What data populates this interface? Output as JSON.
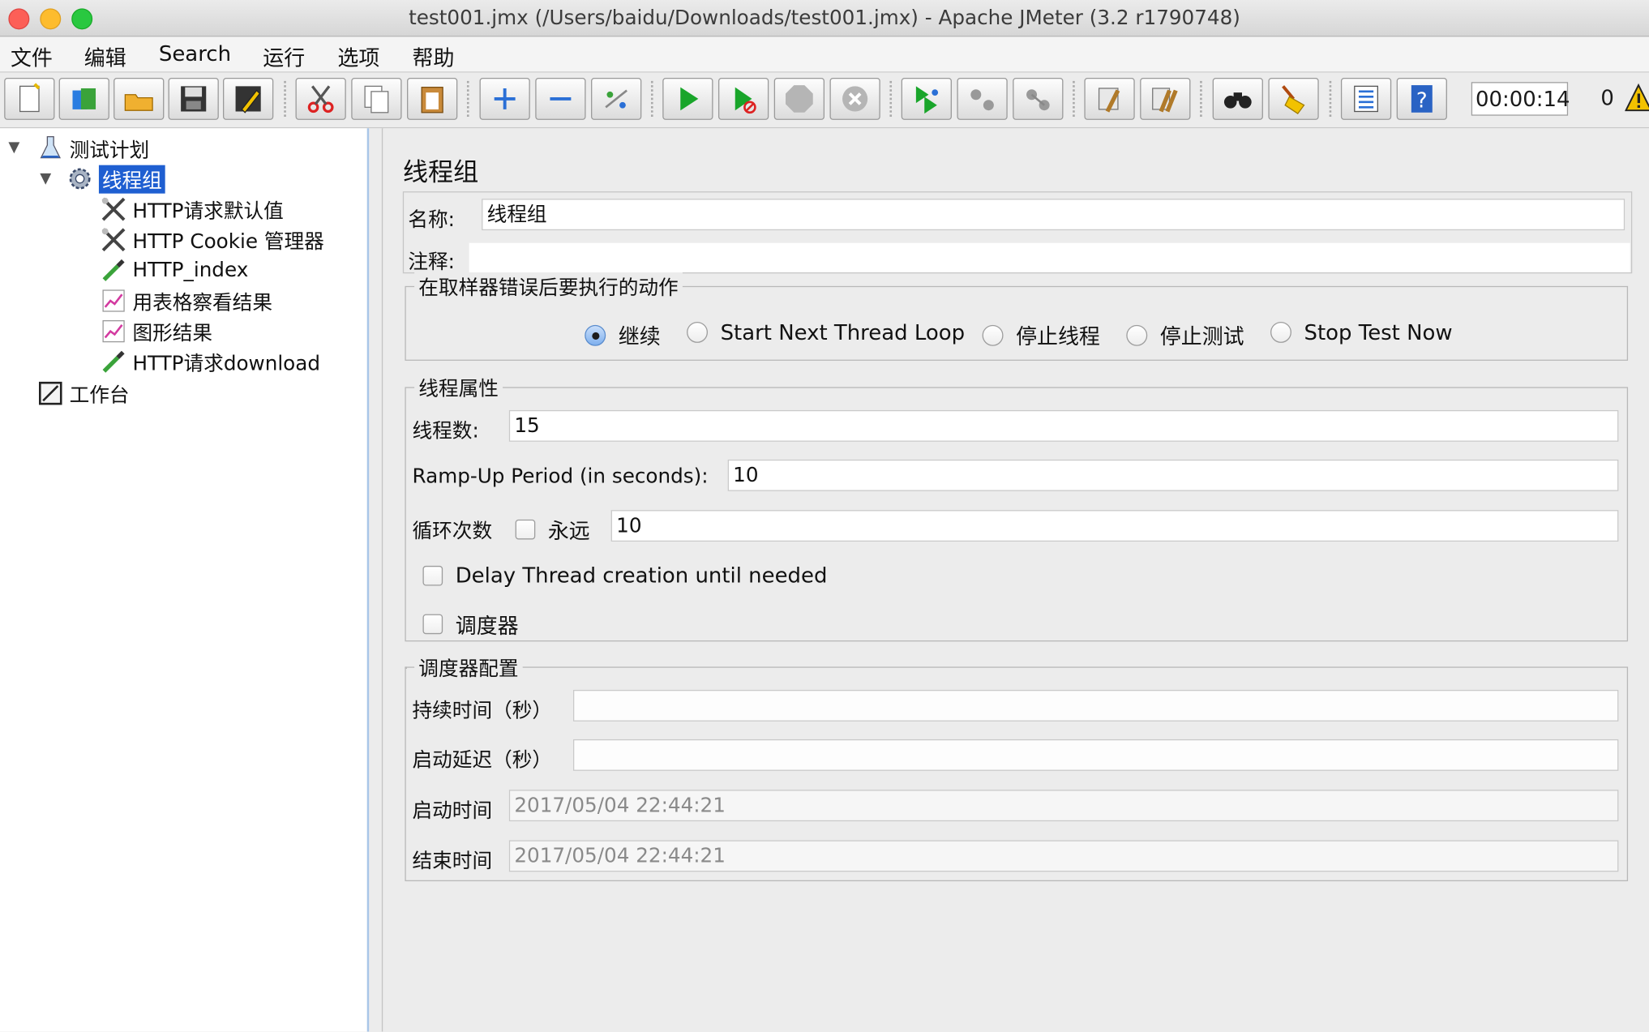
{
  "window": {
    "title": "test001.jmx (/Users/baidu/Downloads/test001.jmx) - Apache JMeter (3.2 r1790748)"
  },
  "menu": [
    "文件",
    "编辑",
    "Search",
    "运行",
    "选项",
    "帮助"
  ],
  "toolbar": {
    "timer": "00:00:14",
    "active_threads": "0",
    "icons": [
      "new-icon",
      "templates-icon",
      "open-icon",
      "save-icon",
      "save-as-icon",
      "cut-icon",
      "copy-icon",
      "paste-icon",
      "expand-icon",
      "collapse-icon",
      "toggle-icon",
      "start-icon",
      "start-no-pause-icon",
      "stop-icon",
      "shutdown-icon",
      "remote-start-icon",
      "remote-stop-icon",
      "remote-shutdown-icon",
      "clear-icon",
      "clear-all-icon",
      "search-icon",
      "reset-search-icon",
      "function-helper-icon",
      "help-icon",
      "warning-icon"
    ]
  },
  "tree": {
    "items": [
      {
        "label": "测试计划"
      },
      {
        "label": "线程组"
      },
      {
        "label": "HTTP请求默认值"
      },
      {
        "label": "HTTP Cookie 管理器"
      },
      {
        "label": "HTTP_index"
      },
      {
        "label": "用表格察看结果"
      },
      {
        "label": "图形结果"
      },
      {
        "label": "HTTP请求download"
      },
      {
        "label": "工作台"
      }
    ]
  },
  "panel": {
    "title": "线程组",
    "name_label": "名称:",
    "name_value": "线程组",
    "comment_label": "注释:",
    "comment_value": "",
    "error_group": {
      "title": "在取样器错误后要执行的动作",
      "options": [
        "继续",
        "Start Next Thread Loop",
        "停止线程",
        "停止测试",
        "Stop Test Now"
      ],
      "selected": "继续"
    },
    "thread_props": {
      "title": "线程属性",
      "threads_label": "线程数:",
      "threads_value": "15",
      "rampup_label": "Ramp-Up Period (in seconds):",
      "rampup_value": "10",
      "loop_label": "循环次数",
      "forever_label": "永远",
      "loop_value": "10",
      "delay_label": "Delay Thread creation until needed",
      "scheduler_label": "调度器"
    },
    "scheduler_config": {
      "title": "调度器配置",
      "duration_label": "持续时间（秒）",
      "duration_value": "",
      "delay_label": "启动延迟（秒）",
      "delay_value": "",
      "start_label": "启动时间",
      "start_value": "2017/05/04 22:44:21",
      "end_label": "结束时间",
      "end_value": "2017/05/04 22:44:21"
    }
  }
}
